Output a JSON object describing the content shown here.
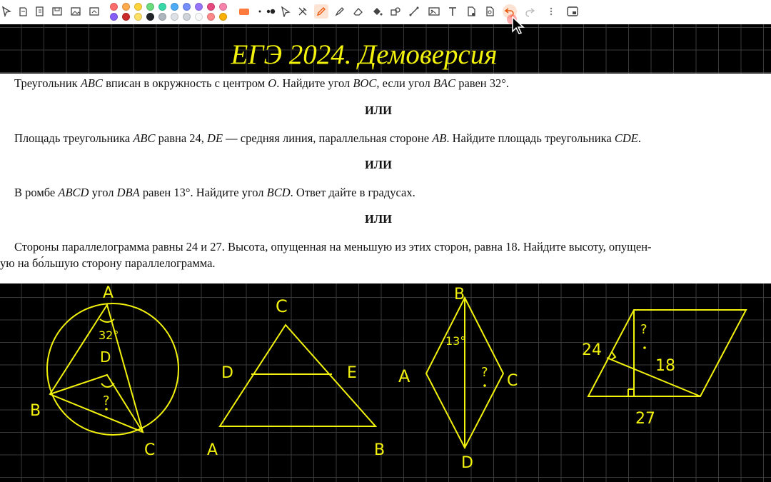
{
  "title": "ЕГЭ 2024. Демоверсия",
  "problems": {
    "p1": {
      "a": "Треугольник ",
      "b": "ABC",
      "c": " вписан в окружность с центром ",
      "d": "O",
      "e": ". Найдите угол ",
      "f": "BOC",
      "g": ", если угол ",
      "h": "BAC",
      "i": " равен 32°."
    },
    "p2": {
      "a": "Площадь треугольника ",
      "b": "ABC",
      "c": " равна 24, ",
      "d": "DE",
      "e": " — средняя линия, параллельная стороне ",
      "f": "AB",
      "g": ". Найдите площадь треугольника ",
      "h": "CDE",
      "i": "."
    },
    "p3": {
      "a": "В ромбе ",
      "b": "ABCD",
      "c": " угол ",
      "d": "DBA",
      "e": " равен 13°. Найдите угол ",
      "f": "BCD",
      "g": ". Ответ дайте в градусах."
    },
    "p4": {
      "line1": "Стороны параллелограмма равны 24 и 27. Высота, опущенная на меньшую из этих сторон, равна 18. Найдите высоту, опущен-",
      "line2": "ую на бо́льшую сторону параллелограмма."
    },
    "or_label": "ИЛИ"
  },
  "figures": {
    "circle_fig": {
      "A": "A",
      "B": "B",
      "C": "C",
      "D": "D",
      "angle": "32°",
      "unknown": "?"
    },
    "triangle_fig": {
      "C": "C",
      "D": "D",
      "E": "E",
      "A": "A",
      "B": "B"
    },
    "rhombus_fig": {
      "B": "B",
      "A": "A",
      "C": "C",
      "D": "D",
      "angle": "13°",
      "unknown": "?"
    },
    "parallelogram_fig": {
      "side_short": "24",
      "side_long": "27",
      "height": "18",
      "unknown": "?"
    }
  },
  "palette": [
    "#ff6b6b",
    "#ffa94d",
    "#ffd43b",
    "#69db7c",
    "#38d9a9",
    "#4dabf7",
    "#748ffc",
    "#9775fa",
    "#e64980",
    "#f783ac",
    "#845ef7",
    "#c92a2a",
    "#ffe066",
    "#212529",
    "#adb5bd",
    "#dee2e6",
    "#ced4da",
    "#f8f9fa",
    "#ff8787",
    "#fab005"
  ],
  "accent_color": "#f2f20d",
  "toolbar_icons": [
    "select-icon",
    "undo-history-icon",
    "copy-icon",
    "save-icon",
    "gallery-icon",
    "color-wheel-icon",
    "pointer-icon",
    "tools-icon",
    "pen-icon",
    "highlighter-icon",
    "eraser-icon",
    "fill-icon",
    "shapes-icon",
    "line-icon",
    "image-icon",
    "text-icon",
    "file-icon",
    "document-icon",
    "undo-icon",
    "redo-icon",
    "more-icon",
    "screen-icon"
  ]
}
